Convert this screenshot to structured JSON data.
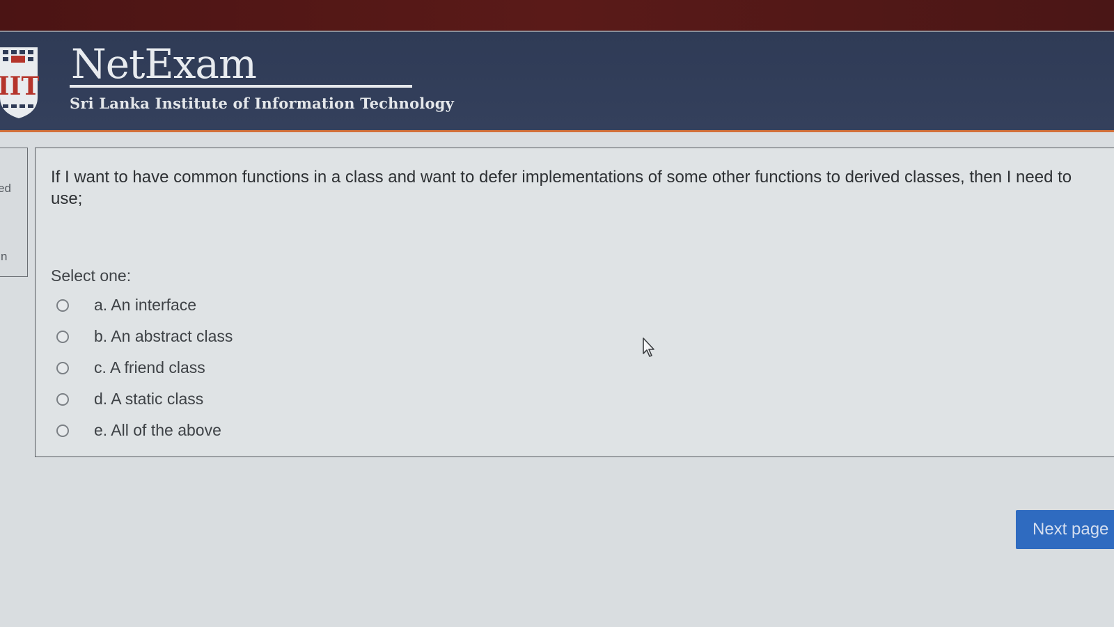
{
  "header": {
    "brand_title": "NetExam",
    "brand_subtitle": "Sri Lanka Institute of Information Technology",
    "logo_icon": "sliit-logo-icon"
  },
  "side_panel": {
    "partial_text_1": "ed",
    "partial_text_2": "n"
  },
  "question": {
    "text": "If I want to have common functions in a  class and want to defer implementations of some other functions to derived classes, then I need to use;",
    "prompt": "Select one:",
    "options": [
      {
        "label": "a. An interface",
        "selected": false
      },
      {
        "label": "b. An abstract class",
        "selected": false
      },
      {
        "label": "c. A friend class",
        "selected": false
      },
      {
        "label": "d. A static class",
        "selected": false
      },
      {
        "label": "e. All of the above",
        "selected": false
      }
    ]
  },
  "navigation": {
    "next_label": "Next page"
  },
  "colors": {
    "header_bg": "#34405c",
    "header_accent": "#d2703a",
    "button_bg": "#2f6bc0"
  }
}
